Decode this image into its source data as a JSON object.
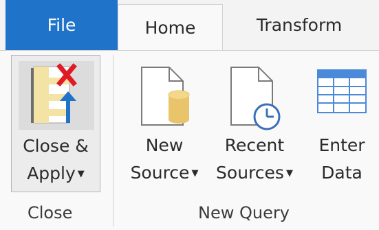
{
  "tabs": [
    {
      "label": "File"
    },
    {
      "label": "Home"
    },
    {
      "label": "Transform"
    }
  ],
  "ribbon": {
    "close_group": {
      "label": "Close",
      "close_apply": {
        "line1": "Close &",
        "line2": "Apply"
      }
    },
    "new_query_group": {
      "label": "New Query",
      "new_source": {
        "line1": "New",
        "line2": "Source"
      },
      "recent_sources": {
        "line1": "Recent",
        "line2": "Sources"
      },
      "enter_data": {
        "line1": "Enter",
        "line2": "Data"
      }
    }
  },
  "icons": {
    "close_apply": "close-apply-icon",
    "new_source": "new-source-icon",
    "recent_sources": "recent-sources-icon",
    "enter_data": "table-icon",
    "dropdown": "caret-down-icon"
  },
  "colors": {
    "file_tab": "#1f73c9",
    "close_x": "#e01b24",
    "apply_arrow": "#1f73c9",
    "database": "#e9c46a",
    "clock": "#3b6fb6",
    "grid": "#4a8ad8"
  }
}
